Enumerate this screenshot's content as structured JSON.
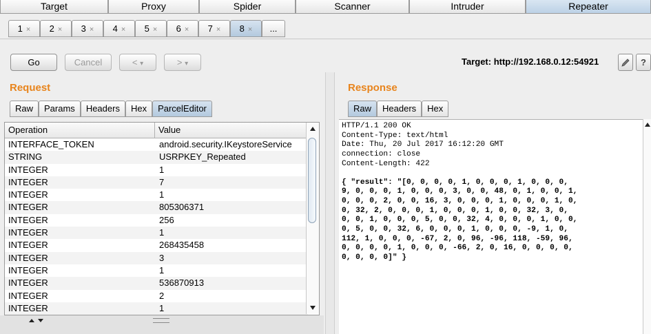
{
  "top_tabs": [
    "Target",
    "Proxy",
    "Spider",
    "Scanner",
    "Intruder",
    "Repeater"
  ],
  "sub_tabs": [
    "1",
    "2",
    "3",
    "4",
    "5",
    "6",
    "7",
    "8"
  ],
  "sub_tab_close": "×",
  "sub_tab_more": "...",
  "toolbar": {
    "go": "Go",
    "cancel": "Cancel",
    "back": "<",
    "forward": ">",
    "dropdown": "▾",
    "target_label": "Target: http://192.168.0.12:54921",
    "edit_icon": "pencil-icon",
    "help": "?"
  },
  "request": {
    "title": "Request",
    "tabs": [
      "Raw",
      "Params",
      "Headers",
      "Hex",
      "ParcelEditor"
    ],
    "columns": [
      "Operation",
      "Value"
    ],
    "rows": [
      [
        "INTERFACE_TOKEN",
        "android.security.IKeystoreService"
      ],
      [
        "STRING",
        "USRPKEY_Repeated"
      ],
      [
        "INTEGER",
        "1"
      ],
      [
        "INTEGER",
        "7"
      ],
      [
        "INTEGER",
        "1"
      ],
      [
        "INTEGER",
        "805306371"
      ],
      [
        "INTEGER",
        "256"
      ],
      [
        "INTEGER",
        "1"
      ],
      [
        "INTEGER",
        "268435458"
      ],
      [
        "INTEGER",
        "3"
      ],
      [
        "INTEGER",
        "1"
      ],
      [
        "INTEGER",
        "536870913"
      ],
      [
        "INTEGER",
        "2"
      ],
      [
        "INTEGER",
        "1"
      ]
    ]
  },
  "response": {
    "title": "Response",
    "tabs": [
      "Raw",
      "Headers",
      "Hex"
    ],
    "headers": "HTTP/1.1 200 OK\nContent-Type: text/html\nDate: Thu, 20 Jul 2017 16:12:20 GMT\nconnection: close\nContent-Length: 422",
    "body": "{ \"result\": \"[0, 0, 0, 0, 1, 0, 0, 0, 1, 0, 0, 0,\n9, 0, 0, 0, 1, 0, 0, 0, 3, 0, 0, 48, 0, 1, 0, 0, 1,\n0, 0, 0, 2, 0, 0, 16, 3, 0, 0, 0, 1, 0, 0, 0, 1, 0,\n0, 32, 2, 0, 0, 0, 1, 0, 0, 0, 1, 0, 0, 32, 3, 0,\n0, 0, 1, 0, 0, 0, 5, 0, 0, 32, 4, 0, 0, 0, 1, 0, 0,\n0, 5, 0, 0, 32, 6, 0, 0, 0, 1, 0, 0, 0, -9, 1, 0,\n112, 1, 0, 0, 0, -67, 2, 0, 96, -96, 118, -59, 96,\n0, 0, 0, 0, 1, 0, 0, 0, -66, 2, 0, 16, 0, 0, 0, 0,\n0, 0, 0, 0]\" }"
  }
}
